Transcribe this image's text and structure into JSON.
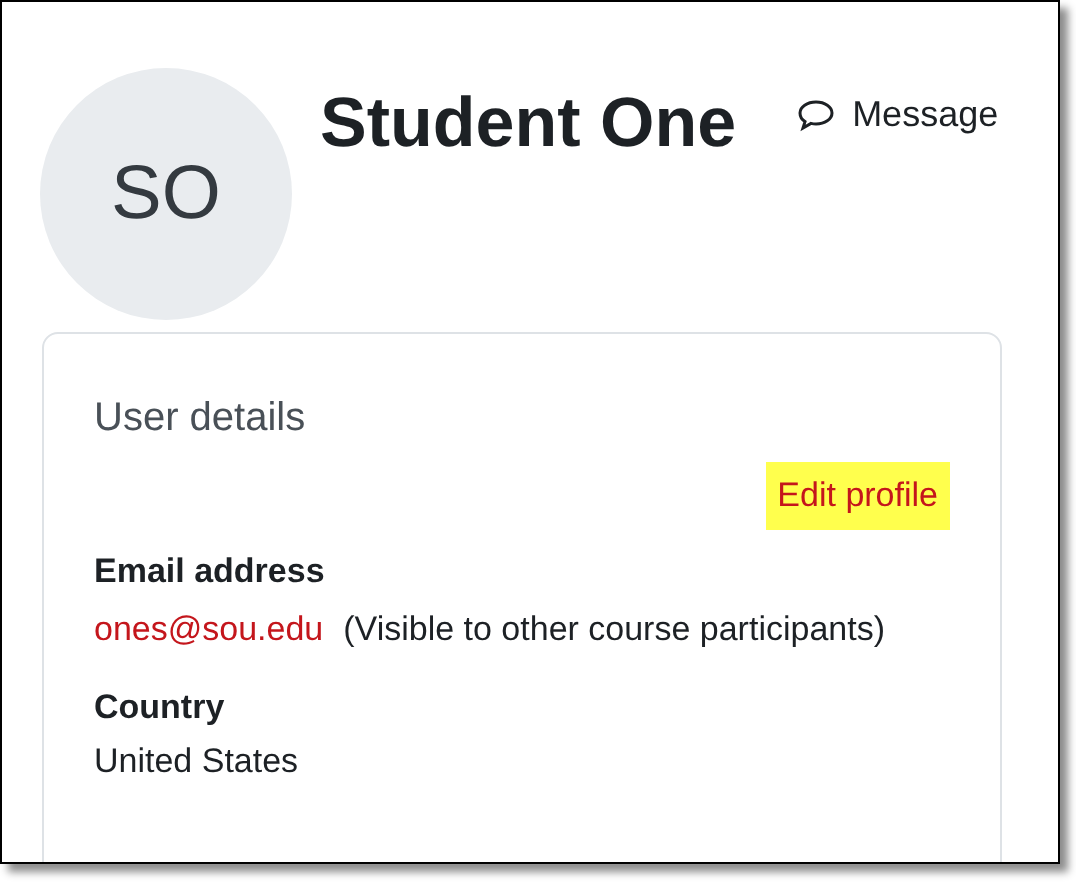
{
  "profile": {
    "initials": "SO",
    "name": "Student One",
    "message_button": "Message"
  },
  "user_details": {
    "title": "User details",
    "edit_link": {
      "label": "Edit profile",
      "highlighted": true
    },
    "fields": [
      {
        "label": "Email address",
        "value": "ones@sou.edu",
        "note": "(Visible to other course participants)",
        "kind": "email"
      },
      {
        "label": "Country",
        "value": "United States",
        "kind": "text"
      }
    ]
  }
}
